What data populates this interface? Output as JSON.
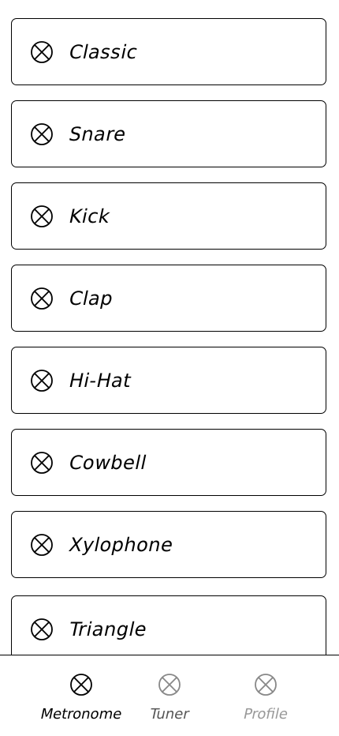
{
  "sounds": {
    "items": [
      {
        "label": "Classic",
        "icon": "circle-x-icon"
      },
      {
        "label": "Snare",
        "icon": "circle-x-icon"
      },
      {
        "label": "Kick",
        "icon": "circle-x-icon"
      },
      {
        "label": "Clap",
        "icon": "circle-x-icon"
      },
      {
        "label": "Hi-Hat",
        "icon": "circle-x-icon"
      },
      {
        "label": "Cowbell",
        "icon": "circle-x-icon"
      },
      {
        "label": "Xylophone",
        "icon": "circle-x-icon"
      },
      {
        "label": "Triangle",
        "icon": "circle-x-icon"
      }
    ]
  },
  "nav": {
    "items": [
      {
        "label": "Metronome",
        "icon": "circle-x-icon",
        "active": true
      },
      {
        "label": "Tuner",
        "icon": "circle-x-icon",
        "active": false
      },
      {
        "label": "Profile",
        "icon": "circle-x-icon",
        "active": false
      }
    ]
  },
  "colors": {
    "foreground": "#000000",
    "inactive": "#888888",
    "background": "#ffffff"
  }
}
